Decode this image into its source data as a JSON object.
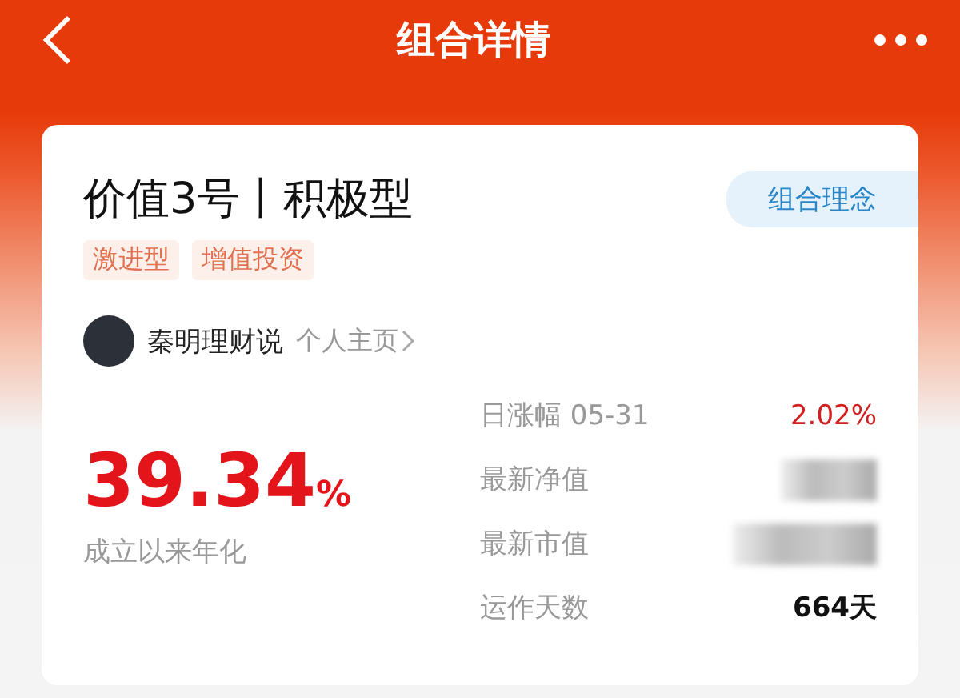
{
  "nav": {
    "title": "组合详情"
  },
  "portfolio": {
    "name": "价值3号丨积极型",
    "philosophy_button": "组合理念",
    "tags": [
      "激进型",
      "增值投资"
    ],
    "author": {
      "name": "秦明理财说",
      "link": "个人主页"
    },
    "annualized": {
      "value": "39.34",
      "unit": "%",
      "label": "成立以来年化"
    },
    "stats": [
      {
        "label": "日涨幅 05-31",
        "kind": "change",
        "value": "2.02%"
      },
      {
        "label": "最新净值",
        "kind": "masked"
      },
      {
        "label": "最新市值",
        "kind": "masked"
      },
      {
        "label": "运作天数",
        "kind": "plain",
        "value": "664天"
      }
    ]
  }
}
